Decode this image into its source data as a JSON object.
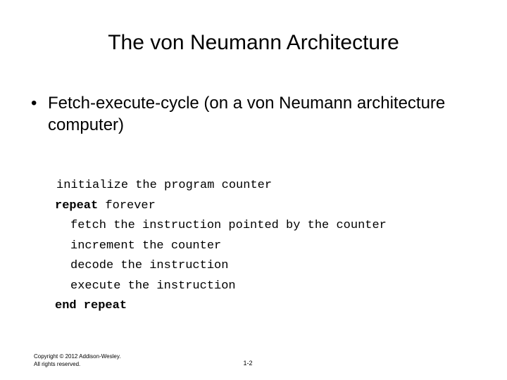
{
  "slide": {
    "title": "The von Neumann Architecture",
    "background_color": "#ffffff",
    "text_color": "#000000"
  },
  "body": {
    "bullets": [
      {
        "marker": "•",
        "text": "Fetch-execute-cycle (on a von Neumann architecture computer)"
      }
    ]
  },
  "code": {
    "lines": [
      {
        "indent": "half",
        "keyword": "",
        "rest": "initialize the program counter"
      },
      {
        "indent": "0",
        "keyword": "repeat",
        "rest": " forever"
      },
      {
        "indent": "1",
        "keyword": "",
        "rest": "fetch the instruction pointed by the counter"
      },
      {
        "indent": "1",
        "keyword": "",
        "rest": "increment the counter"
      },
      {
        "indent": "1",
        "keyword": "",
        "rest": "decode the instruction"
      },
      {
        "indent": "1",
        "keyword": "",
        "rest": "execute the instruction"
      },
      {
        "indent": "0",
        "keyword": "end repeat",
        "rest": ""
      }
    ]
  },
  "footer": {
    "copyright_line1": "Copyright © 2012 Addison-Wesley.",
    "copyright_line2": "All rights reserved.",
    "page_number": "1-2"
  }
}
